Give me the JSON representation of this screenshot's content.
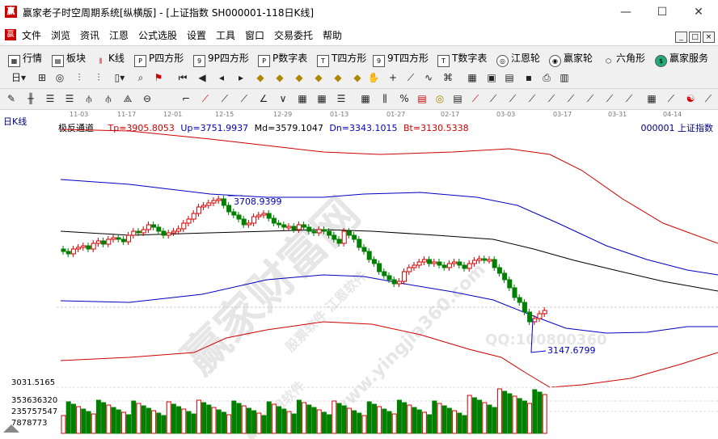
{
  "title": "赢家老子时空周期系统[纵横版] - [上证指数  SH000001-118日K线]",
  "app_icon": "赢",
  "window_buttons": {
    "minimize": "—",
    "maximize": "☐",
    "close": "✕"
  },
  "menu": [
    "文件",
    "浏览",
    "资讯",
    "江恩",
    "公式选股",
    "设置",
    "工具",
    "窗口",
    "交易委托",
    "帮助"
  ],
  "mdi_buttons": [
    "_",
    "□",
    "×"
  ],
  "toolbar1": [
    "行情",
    "板块",
    "K线",
    "P四方形",
    "9P四方形",
    "P数字表",
    "T四方形",
    "9T四方形",
    "T数字表",
    "江恩轮",
    "赢家轮",
    "六角形",
    "赢家服务"
  ],
  "chart": {
    "period_label": "日K线",
    "indicator_name": "极反通道",
    "indicators": [
      {
        "text": "Tp=3905.8053",
        "color": "#d00000"
      },
      {
        "text": "Up=3751.9937",
        "color": "#0000c0"
      },
      {
        "text": "Md=3579.1047",
        "color": "#000000"
      },
      {
        "text": "Dn=3343.1015",
        "color": "#0000c0"
      },
      {
        "text": "Bt=3130.5338",
        "color": "#d00000"
      }
    ],
    "symbol": "000001 上证指数",
    "date_ticks": [
      "11-03",
      "11-17",
      "12-01",
      "12-15",
      "12-29",
      "01-13",
      "01-27",
      "02-17",
      "03-03",
      "03-17",
      "03-31",
      "04-14"
    ],
    "high_annotation": "3708.9399",
    "low_annotation": "3147.6799",
    "price_axis_label": "3031.5165",
    "volume_labels": [
      "353636320",
      "235757547",
      "7878773"
    ],
    "watermarks": [
      "赢家财富网",
      "www.yingjia360.com",
      "股票软件 江恩软件",
      "QQ:100800360",
      "赢家江恩软件"
    ]
  }
}
